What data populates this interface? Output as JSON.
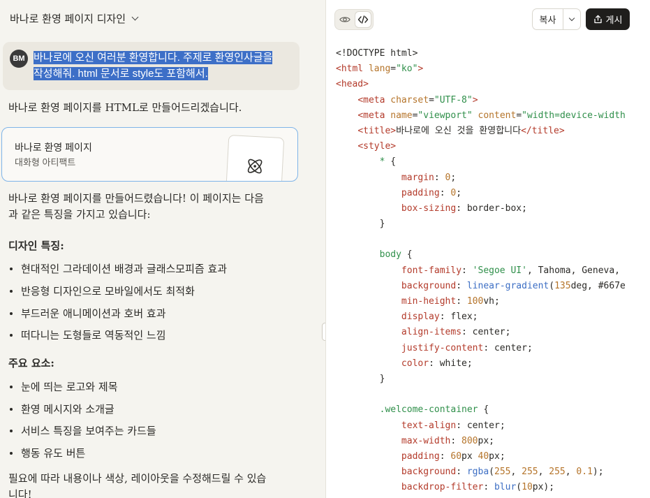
{
  "conversation": {
    "title": "바나로 환영 페이지 디자인",
    "user_avatar": "BM",
    "user_message_line1": "바나로에 오신 여러분 환영합니다. 주제로 환영인사글을",
    "user_message_line2": "작성해줘. html 문서로 style도 포함해서.",
    "assistant_intro": "바나로 환영 페이지를 HTML로 만들어드리겠습니다.",
    "artifact": {
      "title": "바나로 환영 페이지",
      "subtitle": "대화형 아티팩트",
      "icon": "atom-icon"
    },
    "summary_line1": "바나로 환영 페이지를 만들어드렸습니다! 이 페이지는 다음",
    "summary_line2": "과 같은 특징을 가지고 있습니다:",
    "design_heading": "디자인 특징:",
    "design_items": [
      "현대적인 그라데이션 배경과 글래스모피즘 효과",
      "반응형 디자인으로 모바일에서도 최적화",
      "부드러운 애니메이션과 호버 효과",
      "떠다니는 도형들로 역동적인 느낌"
    ],
    "elements_heading": "주요 요소:",
    "element_items": [
      "눈에 띄는 로고와 제목",
      "환영 메시지와 소개글",
      "서비스 특징을 보여주는 카드들",
      "행동 유도 버튼"
    ],
    "closing_line1": "필요에 따라 내용이나 색상, 레이아웃을 수정해드릴 수 있습",
    "closing_line2": "니다!"
  },
  "code_panel": {
    "copy_label": "복사",
    "publish_label": "게시",
    "lines": [
      [
        {
          "c": "",
          "t": "<!DOCTYPE html>"
        }
      ],
      [
        {
          "c": "t",
          "t": "<html"
        },
        {
          "c": "a",
          "t": " lang"
        },
        {
          "c": "",
          "t": "="
        },
        {
          "c": "s",
          "t": "\"ko\""
        },
        {
          "c": "t",
          "t": ">"
        }
      ],
      [
        {
          "c": "t",
          "t": "<head>"
        }
      ],
      [
        {
          "c": "",
          "t": "    "
        },
        {
          "c": "t",
          "t": "<meta"
        },
        {
          "c": "a",
          "t": " charset"
        },
        {
          "c": "",
          "t": "="
        },
        {
          "c": "s",
          "t": "\"UTF-8\""
        },
        {
          "c": "t",
          "t": ">"
        }
      ],
      [
        {
          "c": "",
          "t": "    "
        },
        {
          "c": "t",
          "t": "<meta"
        },
        {
          "c": "a",
          "t": " name"
        },
        {
          "c": "",
          "t": "="
        },
        {
          "c": "s",
          "t": "\"viewport\""
        },
        {
          "c": "a",
          "t": " content"
        },
        {
          "c": "",
          "t": "="
        },
        {
          "c": "s",
          "t": "\"width=device-width"
        }
      ],
      [
        {
          "c": "",
          "t": "    "
        },
        {
          "c": "t",
          "t": "<title>"
        },
        {
          "c": "",
          "t": "바나로에 오신 것을 환영합니다"
        },
        {
          "c": "t",
          "t": "</title>"
        }
      ],
      [
        {
          "c": "",
          "t": "    "
        },
        {
          "c": "t",
          "t": "<style>"
        }
      ],
      [
        {
          "c": "",
          "t": "        "
        },
        {
          "c": "s",
          "t": "*"
        },
        {
          "c": "",
          "t": " {"
        }
      ],
      [
        {
          "c": "",
          "t": "            "
        },
        {
          "c": "t",
          "t": "margin"
        },
        {
          "c": "",
          "t": ": "
        },
        {
          "c": "n",
          "t": "0"
        },
        {
          "c": "",
          "t": ";"
        }
      ],
      [
        {
          "c": "",
          "t": "            "
        },
        {
          "c": "t",
          "t": "padding"
        },
        {
          "c": "",
          "t": ": "
        },
        {
          "c": "n",
          "t": "0"
        },
        {
          "c": "",
          "t": ";"
        }
      ],
      [
        {
          "c": "",
          "t": "            "
        },
        {
          "c": "t",
          "t": "box-sizing"
        },
        {
          "c": "",
          "t": ": border-box;"
        }
      ],
      [
        {
          "c": "",
          "t": "        }"
        }
      ],
      [
        {
          "c": "",
          "t": ""
        }
      ],
      [
        {
          "c": "",
          "t": "        "
        },
        {
          "c": "s",
          "t": "body"
        },
        {
          "c": "",
          "t": " {"
        }
      ],
      [
        {
          "c": "",
          "t": "            "
        },
        {
          "c": "t",
          "t": "font-family"
        },
        {
          "c": "",
          "t": ": "
        },
        {
          "c": "s",
          "t": "'Segoe UI'"
        },
        {
          "c": "",
          "t": ", Tahoma, Geneva,"
        }
      ],
      [
        {
          "c": "",
          "t": "            "
        },
        {
          "c": "t",
          "t": "background"
        },
        {
          "c": "",
          "t": ": "
        },
        {
          "c": "f",
          "t": "linear-gradient"
        },
        {
          "c": "",
          "t": "("
        },
        {
          "c": "n",
          "t": "135"
        },
        {
          "c": "",
          "t": "deg, #667e"
        }
      ],
      [
        {
          "c": "",
          "t": "            "
        },
        {
          "c": "t",
          "t": "min-height"
        },
        {
          "c": "",
          "t": ": "
        },
        {
          "c": "n",
          "t": "100"
        },
        {
          "c": "",
          "t": "vh;"
        }
      ],
      [
        {
          "c": "",
          "t": "            "
        },
        {
          "c": "t",
          "t": "display"
        },
        {
          "c": "",
          "t": ": flex;"
        }
      ],
      [
        {
          "c": "",
          "t": "            "
        },
        {
          "c": "t",
          "t": "align-items"
        },
        {
          "c": "",
          "t": ": center;"
        }
      ],
      [
        {
          "c": "",
          "t": "            "
        },
        {
          "c": "t",
          "t": "justify-content"
        },
        {
          "c": "",
          "t": ": center;"
        }
      ],
      [
        {
          "c": "",
          "t": "            "
        },
        {
          "c": "t",
          "t": "color"
        },
        {
          "c": "",
          "t": ": white;"
        }
      ],
      [
        {
          "c": "",
          "t": "        }"
        }
      ],
      [
        {
          "c": "",
          "t": ""
        }
      ],
      [
        {
          "c": "",
          "t": "        "
        },
        {
          "c": "s",
          "t": ".welcome-container"
        },
        {
          "c": "",
          "t": " {"
        }
      ],
      [
        {
          "c": "",
          "t": "            "
        },
        {
          "c": "t",
          "t": "text-align"
        },
        {
          "c": "",
          "t": ": center;"
        }
      ],
      [
        {
          "c": "",
          "t": "            "
        },
        {
          "c": "t",
          "t": "max-width"
        },
        {
          "c": "",
          "t": ": "
        },
        {
          "c": "n",
          "t": "800"
        },
        {
          "c": "",
          "t": "px;"
        }
      ],
      [
        {
          "c": "",
          "t": "            "
        },
        {
          "c": "t",
          "t": "padding"
        },
        {
          "c": "",
          "t": ": "
        },
        {
          "c": "n",
          "t": "60"
        },
        {
          "c": "",
          "t": "px "
        },
        {
          "c": "n",
          "t": "40"
        },
        {
          "c": "",
          "t": "px;"
        }
      ],
      [
        {
          "c": "",
          "t": "            "
        },
        {
          "c": "t",
          "t": "background"
        },
        {
          "c": "",
          "t": ": "
        },
        {
          "c": "f",
          "t": "rgba"
        },
        {
          "c": "",
          "t": "("
        },
        {
          "c": "n",
          "t": "255"
        },
        {
          "c": "",
          "t": ", "
        },
        {
          "c": "n",
          "t": "255"
        },
        {
          "c": "",
          "t": ", "
        },
        {
          "c": "n",
          "t": "255"
        },
        {
          "c": "",
          "t": ", "
        },
        {
          "c": "n",
          "t": "0.1"
        },
        {
          "c": "",
          "t": ");"
        }
      ],
      [
        {
          "c": "",
          "t": "            "
        },
        {
          "c": "t",
          "t": "backdrop-filter"
        },
        {
          "c": "",
          "t": ": "
        },
        {
          "c": "f",
          "t": "blur"
        },
        {
          "c": "",
          "t": "("
        },
        {
          "c": "n",
          "t": "10"
        },
        {
          "c": "",
          "t": "px);"
        }
      ]
    ]
  }
}
